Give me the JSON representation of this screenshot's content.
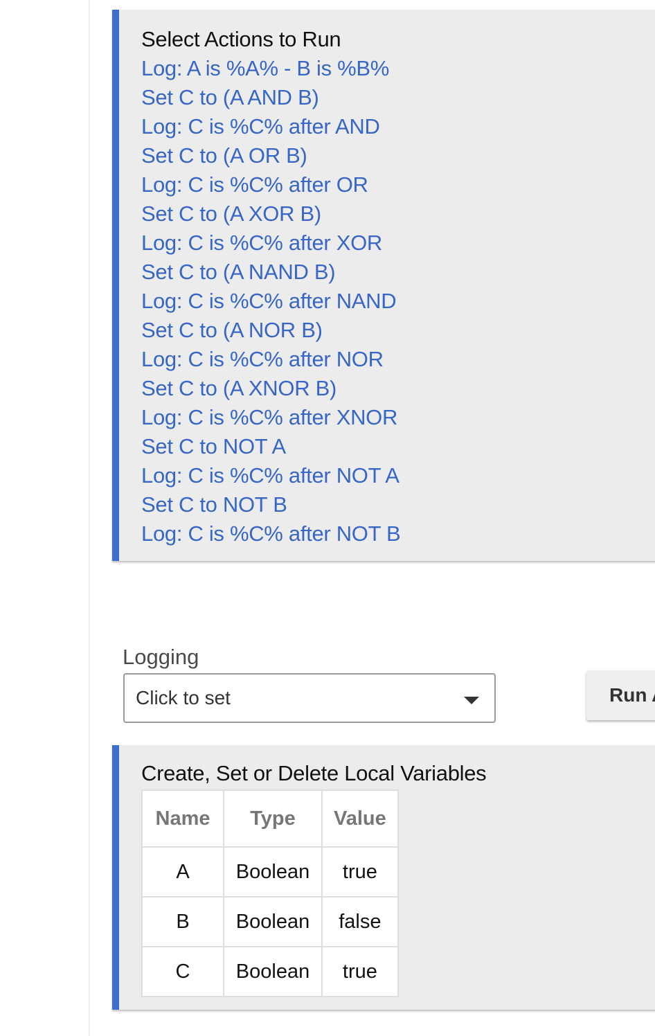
{
  "actions_card": {
    "title": "Select Actions to Run",
    "actions": [
      "Log: A is %A% - B is %B%",
      "Set C to (A AND B)",
      "Log: C is %C% after AND",
      "Set C to (A OR B)",
      "Log: C is %C% after OR",
      "Set C to (A XOR B)",
      "Log: C is %C% after XOR",
      "Set C to (A NAND B)",
      "Log: C is %C% after NAND",
      "Set C to (A NOR B)",
      "Log: C is %C% after NOR",
      "Set C to (A XNOR B)",
      "Log: C is %C% after XNOR",
      "Set C to NOT A",
      "Log: C is %C% after NOT A",
      "Set C to NOT B",
      "Log: C is %C% after NOT B"
    ]
  },
  "logging": {
    "label": "Logging",
    "value": "Click to set",
    "caret_icon": "chevron-down-icon"
  },
  "run_button": {
    "label": "Run A"
  },
  "variables_card": {
    "title": "Create, Set or Delete Local Variables",
    "columns": [
      "Name",
      "Type",
      "Value"
    ],
    "rows": [
      [
        "A",
        "Boolean",
        "true"
      ],
      [
        "B",
        "Boolean",
        "false"
      ],
      [
        "C",
        "Boolean",
        "true"
      ]
    ]
  },
  "colors": {
    "accent": "#3a6fcb",
    "link": "#3766c7",
    "card_bg": "#ececec"
  }
}
